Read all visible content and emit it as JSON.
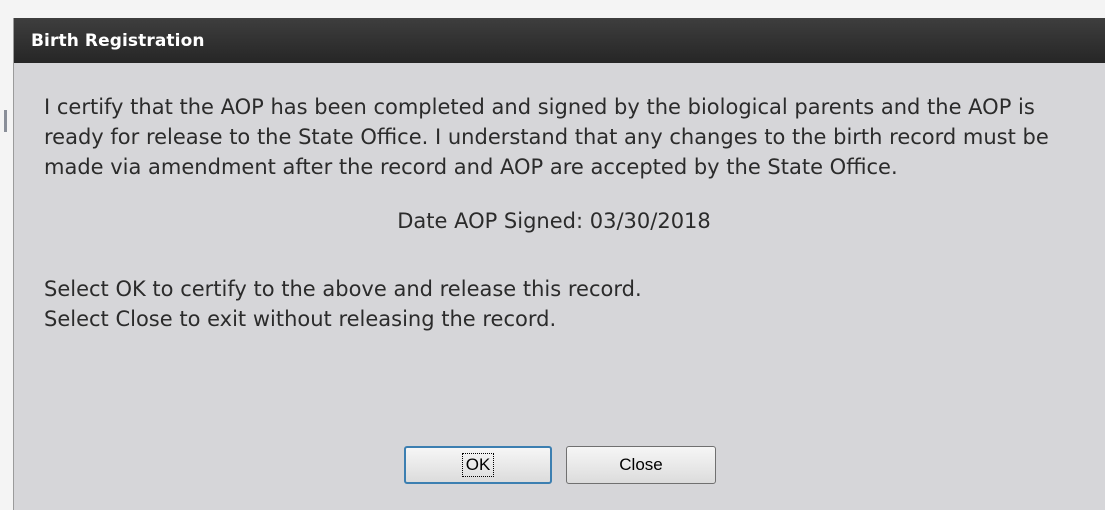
{
  "dialog": {
    "title": "Birth Registration",
    "message": "I certify that the AOP has been completed and signed by the biological parents and the AOP is ready for release to the State Office. I understand that any changes to the birth record must be made via amendment after the record and AOP are accepted by the State Office.",
    "date_line": "Date AOP Signed: 03/30/2018",
    "instructions": [
      "Select OK to certify to the above and release this record.",
      "Select Close to exit without releasing the record."
    ],
    "buttons": {
      "ok_label": "OK",
      "close_label": "Close"
    }
  },
  "colors": {
    "titlebar": "#2f2f2f",
    "dialog_background": "#d6d6d9",
    "focus_border": "#3c7fb1"
  }
}
